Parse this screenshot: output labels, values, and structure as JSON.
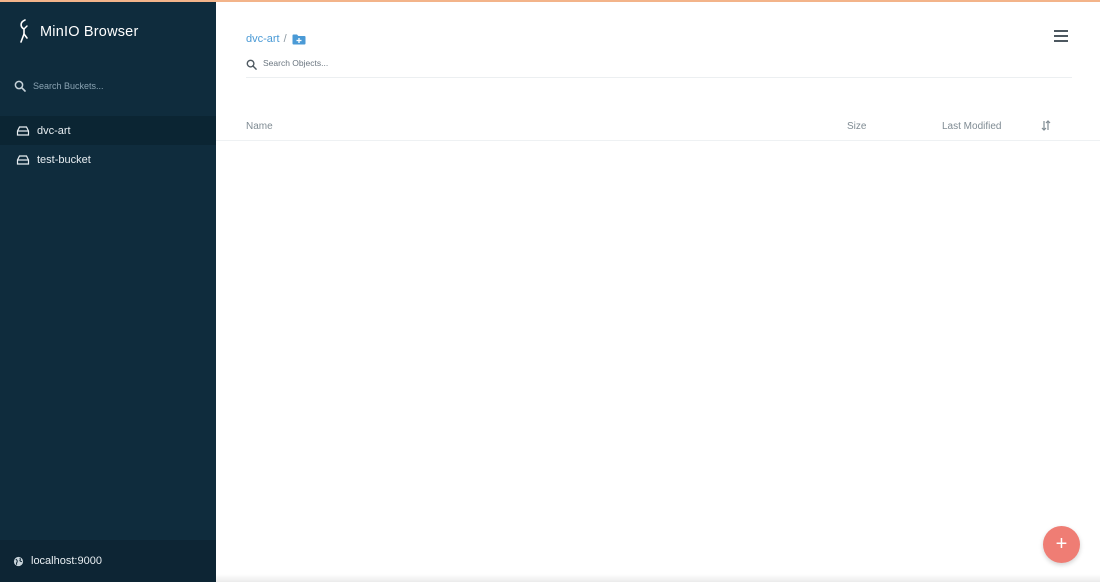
{
  "app": {
    "title": "MinIO Browser"
  },
  "sidebar": {
    "search_placeholder": "Search Buckets...",
    "buckets": [
      {
        "name": "dvc-art",
        "active": true,
        "icon": "bucket-icon"
      },
      {
        "name": "test-bucket",
        "active": false,
        "icon": "bucket-icon"
      }
    ],
    "host": "localhost:9000"
  },
  "main": {
    "breadcrumb": {
      "bucket": "dvc-art",
      "separator": "/"
    },
    "object_search_placeholder": "Search Objects...",
    "table": {
      "columns": {
        "name": "Name",
        "size": "Size",
        "last_modified": "Last Modified"
      },
      "rows": []
    },
    "fab_label": "+"
  },
  "colors": {
    "sidebar_bg": "#0f2c3d",
    "link": "#4a9ad6",
    "fab": "#ef7d74",
    "top_accent": "#f3b48a"
  }
}
